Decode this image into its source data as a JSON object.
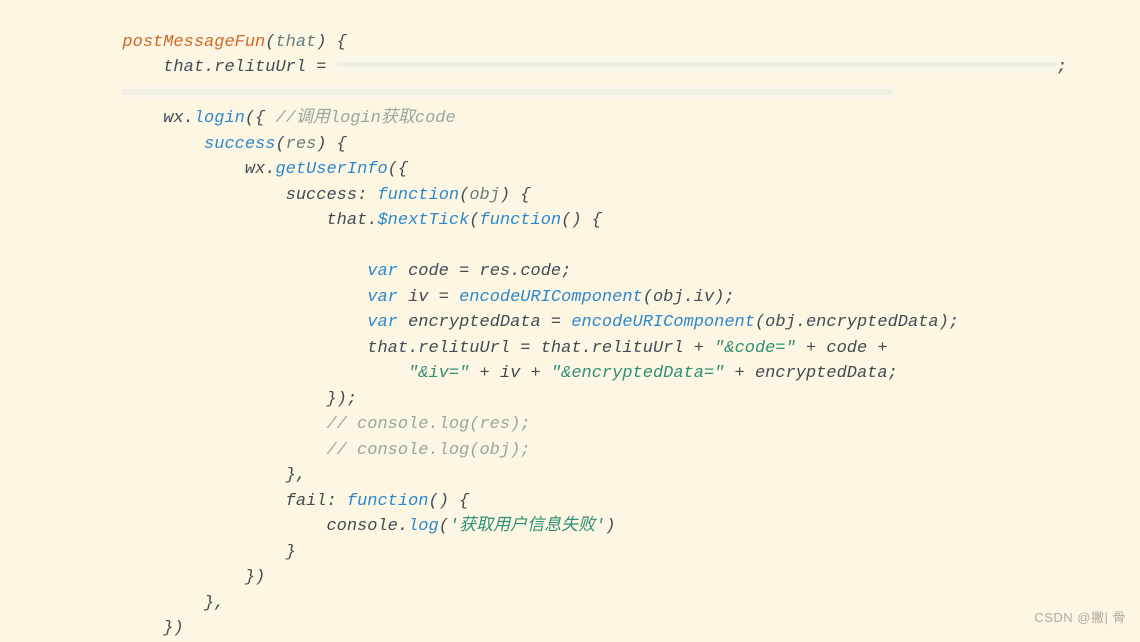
{
  "code": {
    "line1_fn": "postMessageFun",
    "line1_param": "that",
    "line2_assign_left": "that",
    "line2_assign_prop": "relituUrl",
    "line2_op": " = ",
    "line2_end": ";",
    "line4_wx": "wx",
    "line4_login": "login",
    "line4_comment": "//调用login获取code",
    "line5_success": "success",
    "line5_param": "res",
    "line6_wx": "wx",
    "line6_getUserInfo": "getUserInfo",
    "line7_success": "success",
    "line7_function": "function",
    "line7_param": "obj",
    "line8_that": "that",
    "line8_nextTick": "$nextTick",
    "line8_function": "function",
    "line10_var": "var",
    "line10_name": "code",
    "line10_rhs1": "res",
    "line10_rhs2": "code",
    "line11_var": "var",
    "line11_name": "iv",
    "line11_fn": "encodeURIComponent",
    "line11_arg1": "obj",
    "line11_arg2": "iv",
    "line12_var": "var",
    "line12_name": "encryptedData",
    "line12_fn": "encodeURIComponent",
    "line12_arg1": "obj",
    "line12_arg2": "encryptedData",
    "line13_left1": "that",
    "line13_left2": "relituUrl",
    "line13_right1": "that",
    "line13_right2": "relituUrl",
    "line13_str1": "\"&code=\"",
    "line13_id1": "code",
    "line14_str1": "\"&iv=\"",
    "line14_id1": "iv",
    "line14_str2": "\"&encryptedData=\"",
    "line14_id2": "encryptedData",
    "line16_comment": "// console.log(res);",
    "line17_comment": "// console.log(obj);",
    "line19_fail": "fail",
    "line19_function": "function",
    "line20_console": "console",
    "line20_log": "log",
    "line20_str": "'获取用户信息失败'"
  },
  "watermark": "CSDN @撇| 骨"
}
